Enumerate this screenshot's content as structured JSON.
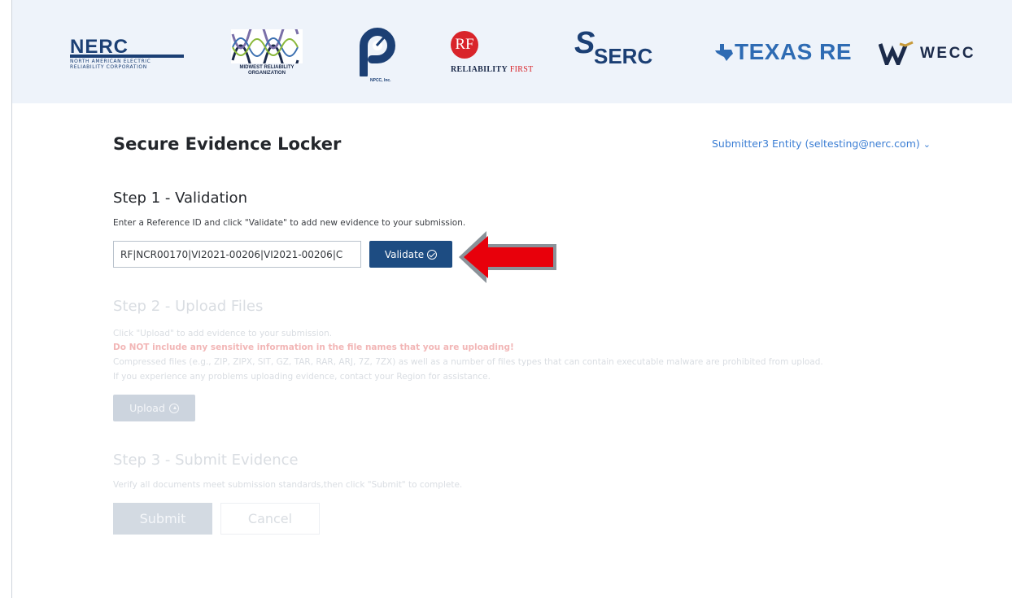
{
  "logos": {
    "nerc": {
      "name": "NERC",
      "sub_line1": "NORTH AMERICAN ELECTRIC",
      "sub_line2": "RELIABILITY CORPORATION"
    },
    "mro": {
      "line1": "MIDWEST RELIABILITY",
      "line2": "ORGANIZATION"
    },
    "npcc": {
      "text": "NPCC, Inc."
    },
    "rf": {
      "mark": "RF",
      "word1": "RELIABILITY",
      "word2": "FIRST"
    },
    "serc": {
      "text": "SERC"
    },
    "texasre": {
      "text": "TEXAS RE"
    },
    "wecc": {
      "text": "WECC"
    }
  },
  "header": {
    "title": "Secure Evidence Locker",
    "user_menu": "Submitter3 Entity (seltesting@nerc.com)"
  },
  "step1": {
    "title": "Step 1 - Validation",
    "description": "Enter a Reference ID and click \"Validate\" to add new evidence to your submission.",
    "reference_value": "RF|NCR00170|VI2021-00206|VI2021-00206|C",
    "validate_label": "Validate"
  },
  "step2": {
    "title": "Step 2 - Upload Files",
    "line1": "Click \"Upload\" to add evidence to your submission.",
    "warning": "Do NOT include any sensitive information in the file names that you are uploading!",
    "line3": "Compressed files (e.g., ZIP, ZIPX, SIT, GZ, TAR, RAR, ARJ, 7Z, 7ZX) as well as a number of files types that can contain executable malware are prohibited from upload.",
    "line4": "If you experience any problems uploading evidence, contact your Region for assistance.",
    "upload_label": "Upload"
  },
  "step3": {
    "title": "Step 3 - Submit Evidence",
    "description": "Verify all documents meet submission standards,then click \"Submit\" to complete.",
    "submit_label": "Submit",
    "cancel_label": "Cancel"
  },
  "colors": {
    "primary": "#1d4c82",
    "link": "#3b7ed4",
    "annotation_arrow": "#e8000b"
  }
}
